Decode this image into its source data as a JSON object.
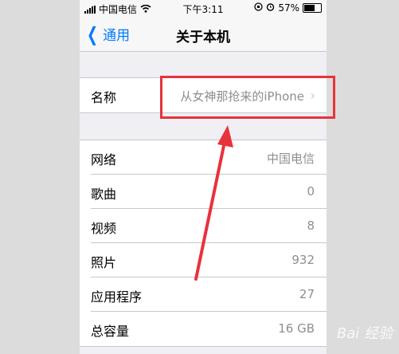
{
  "status_bar": {
    "carrier": "中国电信",
    "time": "下午3:11",
    "battery": "57%",
    "battery_level": 0.57
  },
  "nav": {
    "back_label": "通用",
    "title": "关于本机"
  },
  "name_row": {
    "label": "名称",
    "value": "从女神那抢来的iPhone"
  },
  "info_rows": [
    {
      "label": "网络",
      "value": "中国电信"
    },
    {
      "label": "歌曲",
      "value": "0"
    },
    {
      "label": "视频",
      "value": "8"
    },
    {
      "label": "照片",
      "value": "932"
    },
    {
      "label": "应用程序",
      "value": "27"
    },
    {
      "label": "总容量",
      "value": "16 GB"
    }
  ],
  "watermark": "Bai 经验",
  "colors": {
    "accent": "#007aff",
    "highlight": "#e8323c",
    "background": "#efeff4"
  }
}
